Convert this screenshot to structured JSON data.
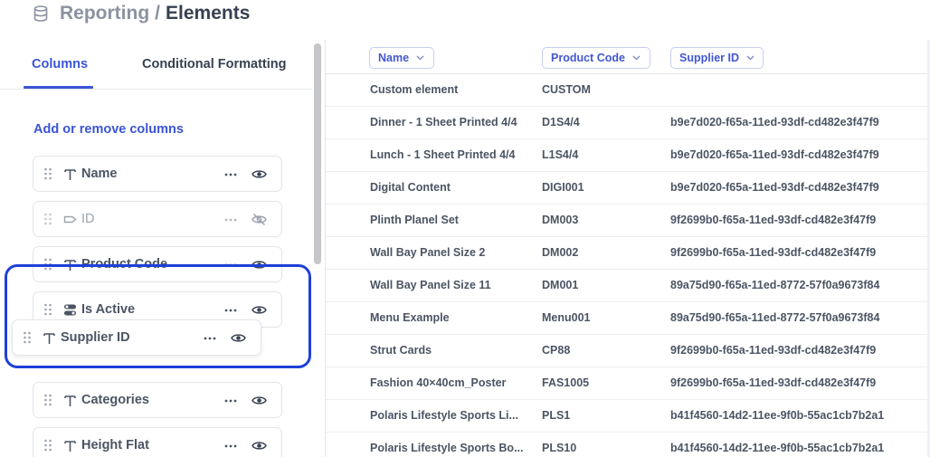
{
  "header": {
    "parent": "Reporting",
    "separator": "/",
    "current": "Elements"
  },
  "tabs": [
    {
      "label": "Columns",
      "active": true
    },
    {
      "label": "Conditional Formatting",
      "active": false
    }
  ],
  "add_remove_label": "Add or remove columns",
  "columns_list": [
    {
      "label": "Name",
      "type_icon": "text-icon",
      "visible": true
    },
    {
      "label": "ID",
      "type_icon": "tag-icon",
      "visible": false
    },
    {
      "label": "Product Code",
      "type_icon": "text-icon",
      "visible": true
    },
    {
      "label": "Is Active",
      "type_icon": "toggle-icon",
      "visible": true
    },
    {
      "label": "Categories",
      "type_icon": "text-icon",
      "visible": true
    },
    {
      "label": "Height Flat",
      "type_icon": "text-icon",
      "visible": true
    }
  ],
  "dragging_column": {
    "label": "Supplier ID",
    "type_icon": "text-icon",
    "visible": true
  },
  "grid": {
    "headers": [
      "Name",
      "Product Code",
      "Supplier ID"
    ],
    "rows": [
      {
        "name": "Custom element",
        "code": "CUSTOM",
        "supplier": ""
      },
      {
        "name": "Dinner - 1 Sheet Printed 4/4",
        "code": "D1S4/4",
        "supplier": "b9e7d020-f65a-11ed-93df-cd482e3f47f9"
      },
      {
        "name": "Lunch - 1 Sheet Printed 4/4",
        "code": "L1S4/4",
        "supplier": "b9e7d020-f65a-11ed-93df-cd482e3f47f9"
      },
      {
        "name": "Digital Content",
        "code": "DIGI001",
        "supplier": "b9e7d020-f65a-11ed-93df-cd482e3f47f9"
      },
      {
        "name": "Plinth Planel Set",
        "code": "DM003",
        "supplier": "9f2699b0-f65a-11ed-93df-cd482e3f47f9"
      },
      {
        "name": "Wall Bay Panel Size 2",
        "code": "DM002",
        "supplier": "9f2699b0-f65a-11ed-93df-cd482e3f47f9"
      },
      {
        "name": "Wall Bay Panel Size 11",
        "code": "DM001",
        "supplier": "89a75d90-f65a-11ed-8772-57f0a9673f84"
      },
      {
        "name": "Menu Example",
        "code": "Menu001",
        "supplier": "89a75d90-f65a-11ed-8772-57f0a9673f84"
      },
      {
        "name": "Strut Cards",
        "code": "CP88",
        "supplier": "9f2699b0-f65a-11ed-93df-cd482e3f47f9"
      },
      {
        "name": "Fashion 40×40cm_Poster",
        "code": "FAS1005",
        "supplier": "9f2699b0-f65a-11ed-93df-cd482e3f47f9"
      },
      {
        "name": "Polaris Lifestyle Sports Li...",
        "code": "PLS1",
        "supplier": "b41f4560-14d2-11ee-9f0b-55ac1cb7b2a1"
      },
      {
        "name": "Polaris Lifestyle Sports Bo...",
        "code": "PLS10",
        "supplier": "b41f4560-14d2-11ee-9f0b-55ac1cb7b2a1"
      }
    ]
  },
  "colors": {
    "accent": "#3b55d6",
    "highlight": "#1e40d8",
    "text": "#4b5563"
  }
}
